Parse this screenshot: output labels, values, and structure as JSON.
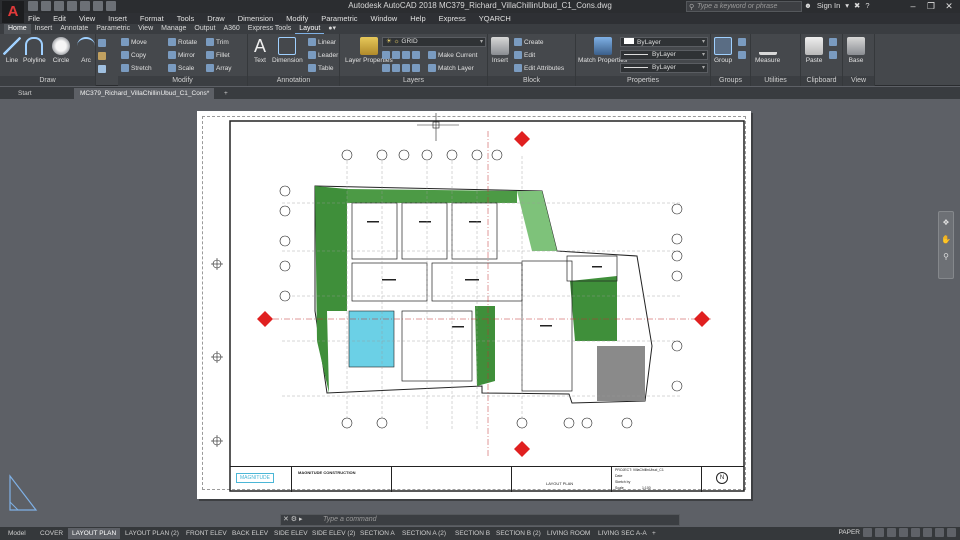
{
  "app": {
    "logo_letter": "A",
    "title": "Autodesk AutoCAD 2018    MC379_Richard_VillaChillinUbud_C1_Cons.dwg",
    "search_placeholder": "Type a keyword or phrase",
    "sign_in": "Sign In"
  },
  "menu": [
    "File",
    "Edit",
    "View",
    "Insert",
    "Format",
    "Tools",
    "Draw",
    "Dimension",
    "Modify",
    "Parametric",
    "Window",
    "Help",
    "Express",
    "YQARCH"
  ],
  "ribbon_tabs": [
    {
      "label": "Home",
      "state": "active"
    },
    {
      "label": "Insert"
    },
    {
      "label": "Annotate"
    },
    {
      "label": "Parametric"
    },
    {
      "label": "View"
    },
    {
      "label": "Manage"
    },
    {
      "label": "Output"
    },
    {
      "label": "A360"
    },
    {
      "label": "Express Tools"
    },
    {
      "label": "Layout",
      "state": "current"
    }
  ],
  "ribbon": {
    "draw": {
      "title": "Draw",
      "line": "Line",
      "polyline": "Polyline",
      "circle": "Circle",
      "arc": "Arc"
    },
    "modify": {
      "title": "Modify",
      "move": "Move",
      "rotate": "Rotate",
      "trim": "Trim",
      "copy": "Copy",
      "mirror": "Mirror",
      "fillet": "Fillet",
      "stretch": "Stretch",
      "scale": "Scale",
      "array": "Array"
    },
    "annotation": {
      "title": "Annotation",
      "text": "Text",
      "dimension": "Dimension",
      "linear": "Linear",
      "leader": "Leader",
      "table": "Table"
    },
    "layers": {
      "title": "Layers",
      "layer_properties": "Layer Properties",
      "current_layer": "GRID",
      "make_current": "Make Current",
      "match_layer": "Match Layer"
    },
    "block": {
      "title": "Block",
      "insert": "Insert",
      "create": "Create",
      "edit": "Edit",
      "edit_attributes": "Edit Attributes"
    },
    "properties": {
      "title": "Properties",
      "match_properties": "Match Properties",
      "color": "ByLayer",
      "linetype": "ByLayer",
      "lineweight": "ByLayer"
    },
    "groups": {
      "title": "Groups",
      "group": "Group"
    },
    "utilities": {
      "title": "Utilities",
      "measure": "Measure"
    },
    "clipboard": {
      "title": "Clipboard",
      "paste": "Paste"
    },
    "view": {
      "title": "View",
      "base": "Base"
    }
  },
  "file_tabs": [
    {
      "label": "Start"
    },
    {
      "label": "MC379_Richard_VillaChillinUbud_C1_Cons*",
      "active": true
    }
  ],
  "sheet": {
    "logo_text": "MAGNITUDE",
    "company": "MAGNITUDE CONSTRUCTION",
    "drawing_title": "LAYOUT PLAN",
    "project": "PROJECT: VillaChillinUbud_C1",
    "date_label": "Date",
    "sketch_label": "Sketch by",
    "scale_label": "Scale",
    "scale_value": "1:100",
    "north": "N"
  },
  "command": {
    "placeholder": "Type a command"
  },
  "layout_tabs": [
    {
      "label": "Model"
    },
    {
      "label": "COVER"
    },
    {
      "label": "LAYOUT PLAN",
      "active": true
    },
    {
      "label": "LAYOUT PLAN (2)"
    },
    {
      "label": "FRONT ELEV"
    },
    {
      "label": "BACK ELEV"
    },
    {
      "label": "SIDE ELEV"
    },
    {
      "label": "SIDE ELEV (2)"
    },
    {
      "label": "SECTION A"
    },
    {
      "label": "SECTION A (2)"
    },
    {
      "label": "SECTION B"
    },
    {
      "label": "SECTION B (2)"
    },
    {
      "label": "LIVING ROOM"
    },
    {
      "label": "LIVING SEC A-A"
    }
  ],
  "status": {
    "mode": "PAPER"
  },
  "colors": {
    "accent": "#e03a3a",
    "vegetation": "#3f8f3a",
    "pool": "#6bd0e6",
    "tab_highlight": "#7fb1e6"
  }
}
